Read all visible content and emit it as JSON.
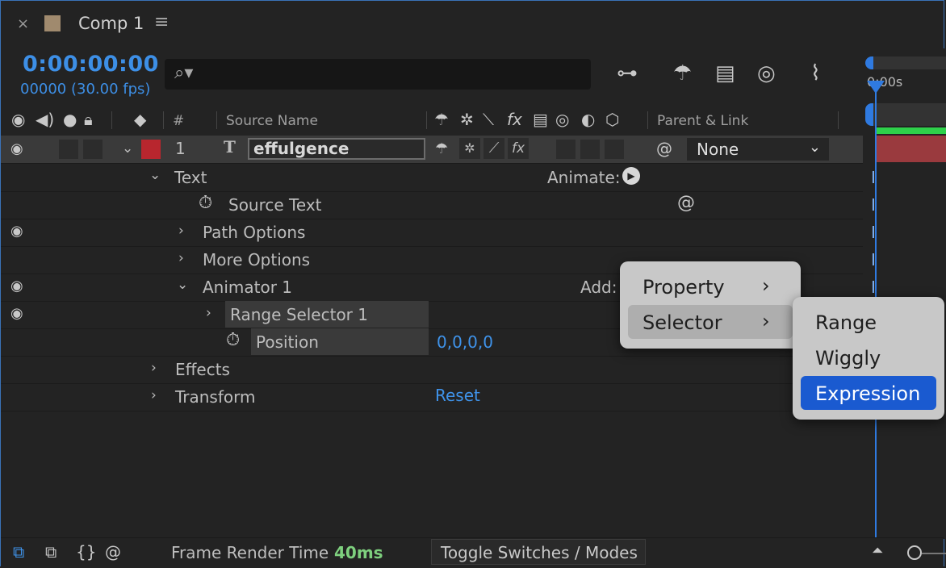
{
  "tab": {
    "close": "×",
    "title": "Comp 1",
    "menu": "≡",
    "swatch_color": "#a08a6e"
  },
  "time": {
    "timecode": "0:00:00:00",
    "frames": "00000 (30.00 fps)"
  },
  "search": {
    "placeholder": ""
  },
  "header": {
    "hash": "#",
    "source_name": "Source Name",
    "parent_link": "Parent & Link"
  },
  "layer": {
    "number": "1",
    "type_glyph": "T",
    "name": "effulgence",
    "parent": "None",
    "label_color": "#b8262e"
  },
  "properties": {
    "text": "Text",
    "animate": "Animate:",
    "source_text": "Source Text",
    "path_options": "Path Options",
    "more_options": "More Options",
    "animator": "Animator 1",
    "add": "Add:",
    "range_selector": "Range Selector 1",
    "position": "Position",
    "position_value": "0,0,0,0",
    "effects": "Effects",
    "transform": "Transform",
    "reset": "Reset"
  },
  "timeline": {
    "ruler_label": "0:00s"
  },
  "bottom": {
    "render_label": "Frame Render Time",
    "render_value": "40ms",
    "toggle": "Toggle Switches / Modes"
  },
  "menu_main": {
    "items": [
      "Property",
      "Selector"
    ]
  },
  "menu_sub": {
    "items": [
      "Range",
      "Wiggly",
      "Expression"
    ]
  },
  "colors": {
    "accent": "#3d8fe6",
    "highlight": "#1a5ad0",
    "render_value": "#7ed07e"
  }
}
